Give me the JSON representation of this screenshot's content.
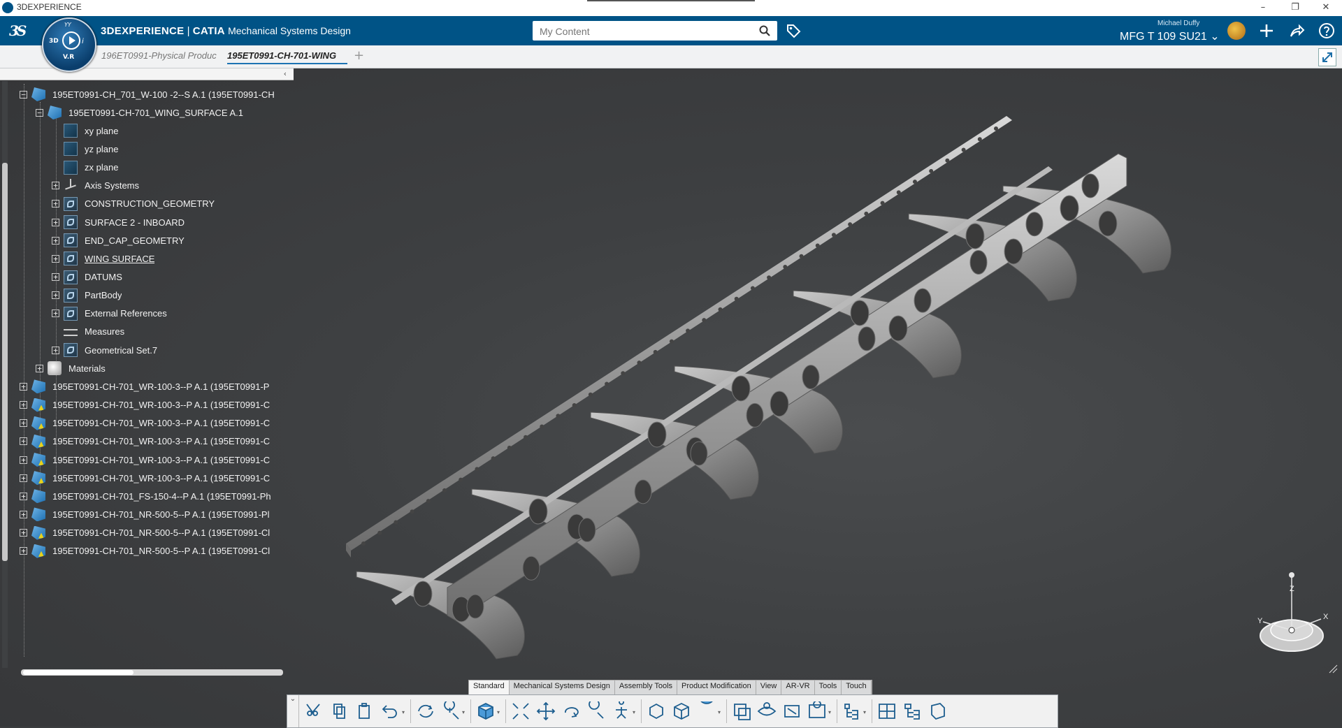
{
  "window": {
    "title": "3DEXPERIENCE",
    "controls": [
      "–",
      "❐",
      "✕"
    ]
  },
  "header": {
    "brand_main": "3DEXPERIENCE",
    "brand_sep": " | ",
    "brand_product": "CATIA",
    "brand_app": "Mechanical Systems Design",
    "search_placeholder": "My Content",
    "user_name": "Michael Duffy",
    "collab_space": "MFG T 109 SU21",
    "compass": {
      "label_3d": "3D",
      "label_vr": "V.R",
      "label_i": "i",
      "label_top": "YY"
    },
    "icons": [
      "search-icon",
      "tag-icon",
      "avatar",
      "add-icon",
      "share-icon",
      "help-icon"
    ]
  },
  "tabs": [
    {
      "label": "196ET0991-Physical Produc",
      "active": false
    },
    {
      "label": "195ET0991-CH-701-WING",
      "active": true
    }
  ],
  "tab_add": "+",
  "tree": {
    "collapse_arrow": "‹",
    "rows": [
      {
        "label": "195ET0991-CH_701_W-100 -2--S A.1 (195ET0991-CH",
        "icon": "product",
        "expander": "−"
      },
      {
        "label": "195ET0991-CH-701_WING_SURFACE A.1",
        "icon": "product",
        "expander": "−"
      },
      {
        "label": "xy plane",
        "icon": "plane",
        "expander": ""
      },
      {
        "label": "yz plane",
        "icon": "plane",
        "expander": ""
      },
      {
        "label": "zx plane",
        "icon": "plane",
        "expander": ""
      },
      {
        "label": "Axis Systems",
        "icon": "axis",
        "expander": "+"
      },
      {
        "label": "CONSTRUCTION_GEOMETRY",
        "icon": "geoset",
        "expander": "+"
      },
      {
        "label": "SURFACE 2 - INBOARD",
        "icon": "geoset",
        "expander": "+"
      },
      {
        "label": "END_CAP_GEOMETRY",
        "icon": "geoset",
        "expander": "+"
      },
      {
        "label": "WING SURFACE",
        "icon": "geoset",
        "expander": "+"
      },
      {
        "label": "DATUMS",
        "icon": "geoset",
        "expander": "+"
      },
      {
        "label": "PartBody",
        "icon": "geoset",
        "expander": "+"
      },
      {
        "label": "External References",
        "icon": "geoset",
        "expander": "+"
      },
      {
        "label": "Measures",
        "icon": "measure",
        "expander": ""
      },
      {
        "label": "Geometrical Set.7",
        "icon": "geoset",
        "expander": "+"
      },
      {
        "label": "Materials",
        "icon": "material",
        "expander": "+"
      },
      {
        "label": "195ET0991-CH-701_WR-100-3--P A.1 (195ET0991-P",
        "icon": "product",
        "expander": "+"
      },
      {
        "label": "195ET0991-CH-701_WR-100-3--P A.1 (195ET0991-C",
        "icon": "product-y",
        "expander": "+"
      },
      {
        "label": "195ET0991-CH-701_WR-100-3--P A.1 (195ET0991-C",
        "icon": "product-y",
        "expander": "+"
      },
      {
        "label": "195ET0991-CH-701_WR-100-3--P A.1 (195ET0991-C",
        "icon": "product-y",
        "expander": "+"
      },
      {
        "label": "195ET0991-CH-701_WR-100-3--P A.1 (195ET0991-C",
        "icon": "product-y",
        "expander": "+"
      },
      {
        "label": "195ET0991-CH-701_WR-100-3--P A.1 (195ET0991-C",
        "icon": "product-y",
        "expander": "+"
      },
      {
        "label": "195ET0991-CH-701_FS-150-4--P A.1 (195ET0991-Ph",
        "icon": "product",
        "expander": "+"
      },
      {
        "label": "195ET0991-CH-701_NR-500-5--P A.1 (195ET0991-Pl",
        "icon": "product",
        "expander": "+"
      },
      {
        "label": "195ET0991-CH-701_NR-500-5--P A.1 (195ET0991-Cl",
        "icon": "product-y",
        "expander": "+"
      },
      {
        "label": "195ET0991-CH-701_NR-500-5--P A.1 (195ET0991-Cl",
        "icon": "product-y",
        "expander": "+"
      }
    ]
  },
  "action_bar": {
    "tabs": [
      "Standard",
      "Mechanical Systems Design",
      "Assembly Tools",
      "Product Modification",
      "View",
      "AR-VR",
      "Tools",
      "Touch"
    ],
    "active_tab": "Standard",
    "tools": [
      "cut-icon",
      "copy-icon",
      "paste-icon",
      "undo-icon",
      "update-icon",
      "zoom-area-icon",
      "3d-view-icon",
      "fit-all-icon",
      "pan-icon",
      "rotate-icon",
      "zoom-icon",
      "look-at-icon",
      "normal-view-icon",
      "iso-view-icon",
      "render-style-icon",
      "shading-icon",
      "hide-show-icon",
      "swap-visible-icon",
      "capture-icon",
      "tree-icon",
      "layout-icon",
      "expand-tree-icon",
      "product-icon"
    ]
  },
  "robot": {
    "z": "Z",
    "x": "X",
    "y": "Y"
  },
  "colors": {
    "header_blue": "#005386",
    "viewport_bg": "#3e4042",
    "tree_text": "#f2f2f2"
  }
}
